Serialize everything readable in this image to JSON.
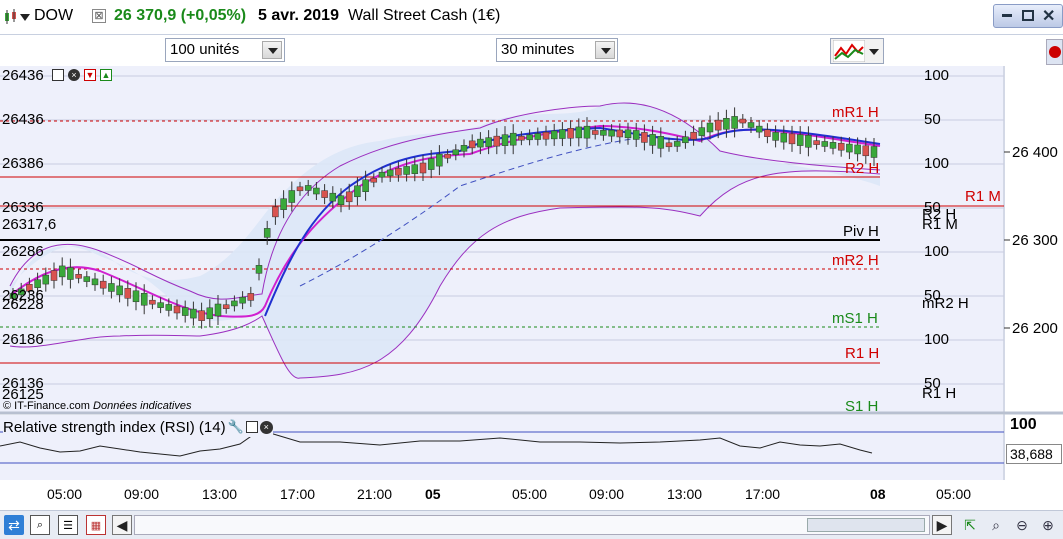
{
  "header": {
    "symbol": "DOW",
    "price": "26 370,9 (+0,05%)",
    "date": "5 avr. 2019",
    "instrument": "Wall Street Cash (1€)",
    "price_color": "#1a8a1a"
  },
  "toolbar": {
    "units_value": "100 unités",
    "interval_value": "30 minutes"
  },
  "price_axis": {
    "labels": [
      "26 400",
      "26 300",
      "26 200"
    ]
  },
  "left_levels": [
    "26436",
    "26386",
    "26336",
    "26317,6",
    "26286",
    "26236",
    "26228",
    "26186",
    "26136",
    "26125"
  ],
  "right_ticks": [
    "100",
    "50",
    "100",
    "50",
    "100",
    "50",
    "100",
    "50"
  ],
  "pivot_labels": {
    "mR1H": "mR1 H",
    "R2H": "R2 H",
    "R1M": "R1 M",
    "R2H_2": "R2 H",
    "R1M_2": "R1 M",
    "PivH": "Piv H",
    "mR2H": "mR2 H",
    "mR2H_2": "mR2 H",
    "mS1H": "mS1 H",
    "R1H": "R1 H",
    "S1H": "S1 H",
    "R1H_2": "R1 H"
  },
  "footer": {
    "source": "© IT-Finance.com",
    "note": "Données indicatives"
  },
  "rsi": {
    "title": "Relative strength index (RSI) (14)",
    "value": "38,688",
    "scale_top": "100"
  },
  "time_axis": {
    "labels": [
      "05:00",
      "09:00",
      "13:00",
      "17:00",
      "21:00",
      "05",
      "05:00",
      "09:00",
      "13:00",
      "17:00",
      "08",
      "05:00"
    ]
  },
  "colors": {
    "up": "#3aa83a",
    "down": "#d9534f",
    "band_fill": "#dbe7f7",
    "band_line": "#9b30c0",
    "ma_blue": "#2030d0",
    "ma_magenta": "#d020d0",
    "resistance": "#d00000",
    "support": "#1a8a1a"
  }
}
